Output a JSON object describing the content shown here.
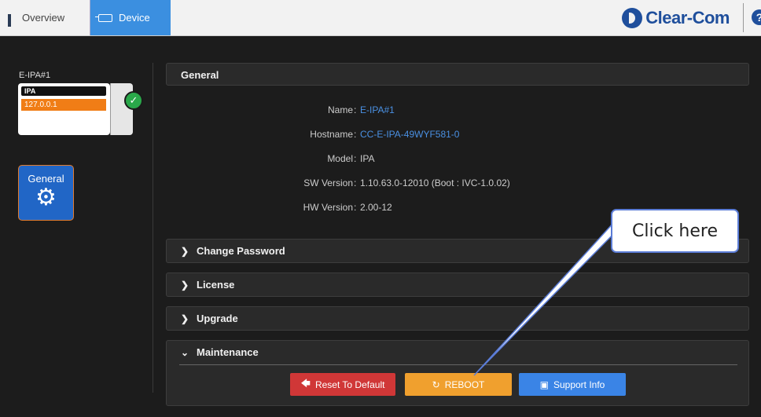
{
  "header": {
    "tabs": [
      {
        "label": "Overview",
        "icon": "grid-icon",
        "active": false
      },
      {
        "label": "Device",
        "icon": "device-icon",
        "active": true
      }
    ],
    "brand": "Clear-Com",
    "help": "?"
  },
  "sidebar": {
    "device_label": "E-IPA#1",
    "card": {
      "model": "IPA",
      "ip": "127.0.0.1",
      "status": "ok"
    },
    "nav": [
      {
        "label": "General",
        "icon": "gear-icon",
        "active": true
      }
    ]
  },
  "general": {
    "title": "General",
    "rows": [
      {
        "label": "Name",
        "value": "E-IPA#1",
        "link": true
      },
      {
        "label": "Hostname",
        "value": "CC-E-IPA-49WYF581-0",
        "link": true
      },
      {
        "label": "Model",
        "value": "IPA",
        "link": false
      },
      {
        "label": "SW Version",
        "value": "1.10.63.0-12010 (Boot : IVC-1.0.02)",
        "link": false
      },
      {
        "label": "HW Version",
        "value": "2.00-12",
        "link": false
      }
    ]
  },
  "sections": {
    "change_password": "Change Password",
    "license": "License",
    "upgrade": "Upgrade",
    "maintenance": "Maintenance"
  },
  "buttons": {
    "reset": "Reset To Default",
    "reboot": "REBOOT",
    "support": "Support Info"
  },
  "callout": "Click here",
  "colors": {
    "accent": "#3b8fe0",
    "reset": "#d03737",
    "reboot": "#f0a02e",
    "support": "#3a84e6",
    "ip_badge": "#f07d16"
  }
}
